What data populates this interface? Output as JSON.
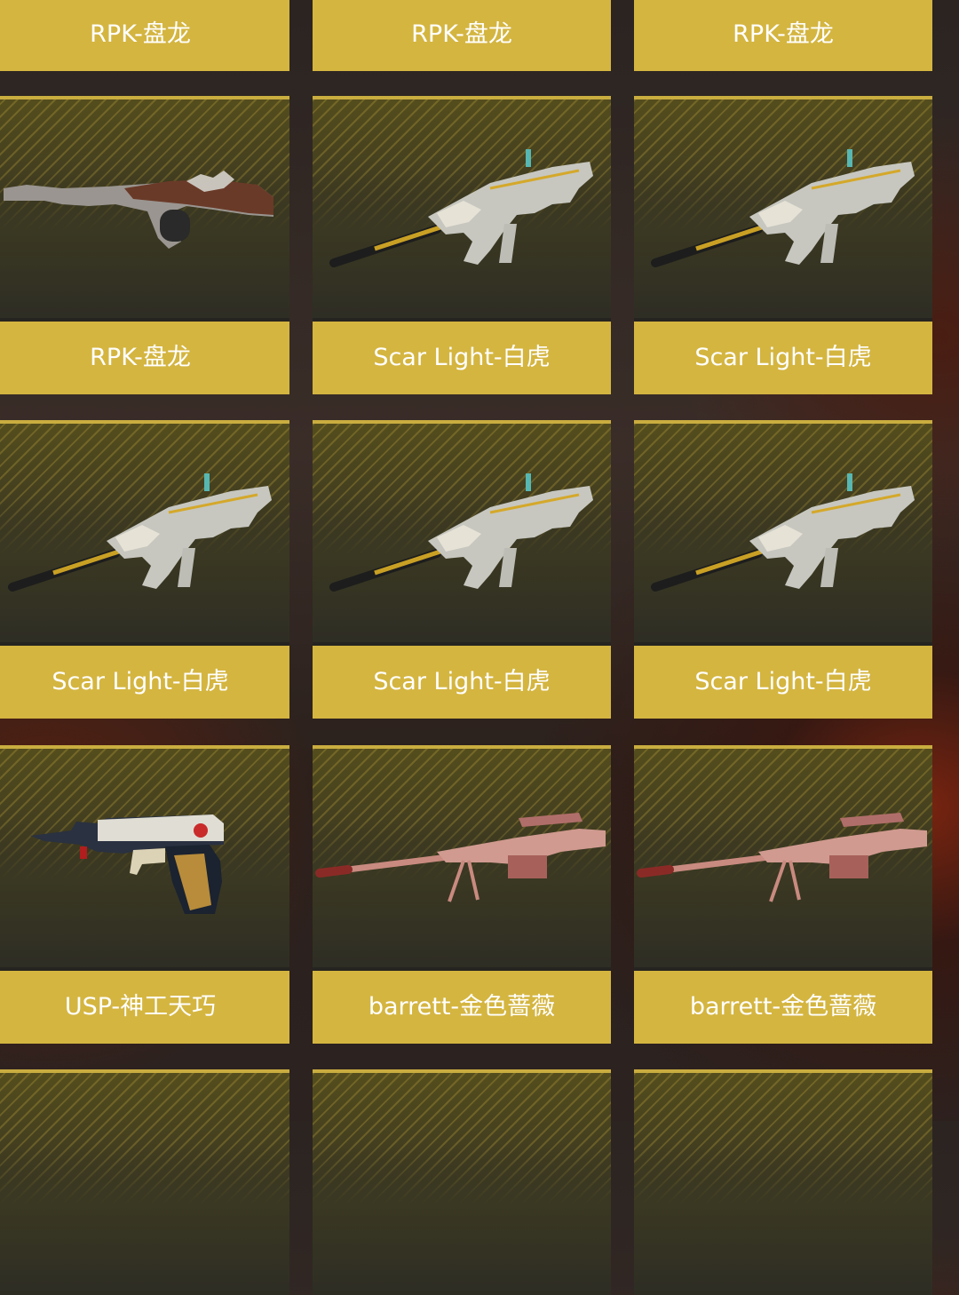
{
  "items": [
    {
      "label": "RPK-盘龙",
      "weapon": "rpk-dragon-icon"
    },
    {
      "label": "RPK-盘龙",
      "weapon": "rpk-dragon-icon"
    },
    {
      "label": "RPK-盘龙",
      "weapon": "rpk-dragon-icon"
    },
    {
      "label": "RPK-盘龙",
      "weapon": "rpk-dragon-icon"
    },
    {
      "label": "Scar Light-白虎",
      "weapon": "scar-light-tiger-icon"
    },
    {
      "label": "Scar Light-白虎",
      "weapon": "scar-light-tiger-icon"
    },
    {
      "label": "Scar Light-白虎",
      "weapon": "scar-light-tiger-icon"
    },
    {
      "label": "Scar Light-白虎",
      "weapon": "scar-light-tiger-icon"
    },
    {
      "label": "Scar Light-白虎",
      "weapon": "scar-light-tiger-icon"
    },
    {
      "label": "USP-神工天巧",
      "weapon": "usp-pistol-icon"
    },
    {
      "label": "barrett-金色蔷薇",
      "weapon": "barrett-rose-icon"
    },
    {
      "label": "barrett-金色蔷薇",
      "weapon": "barrett-rose-icon"
    },
    {
      "label": "",
      "weapon": ""
    },
    {
      "label": "",
      "weapon": ""
    },
    {
      "label": "",
      "weapon": ""
    }
  ],
  "colors": {
    "label_bg": "#d4b540",
    "label_text": "#ffffff",
    "card_border": "#c9ad3f"
  }
}
